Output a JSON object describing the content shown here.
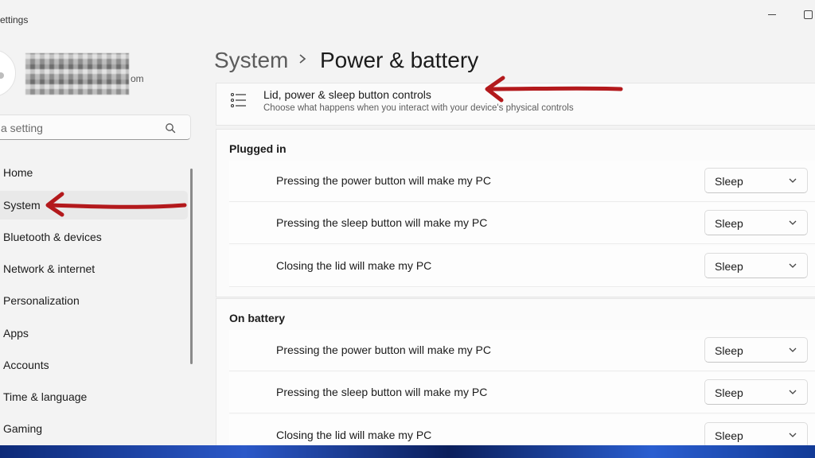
{
  "window": {
    "app_title": "ettings"
  },
  "account": {
    "email_suffix": "om"
  },
  "search": {
    "placeholder": "a setting"
  },
  "sidebar": {
    "items": [
      {
        "label": "Home"
      },
      {
        "label": "System"
      },
      {
        "label": "Bluetooth & devices"
      },
      {
        "label": "Network & internet"
      },
      {
        "label": "Personalization"
      },
      {
        "label": "Apps"
      },
      {
        "label": "Accounts"
      },
      {
        "label": "Time & language"
      },
      {
        "label": "Gaming"
      }
    ]
  },
  "header": {
    "breadcrumb_parent": "System",
    "title": "Power & battery"
  },
  "lid_card": {
    "title": "Lid, power & sleep button controls",
    "description": "Choose what happens when you interact with your device's physical controls"
  },
  "plugged_in": {
    "title": "Plugged in",
    "rows": [
      {
        "label": "Pressing the power button will make my PC",
        "value": "Sleep"
      },
      {
        "label": "Pressing the sleep button will make my PC",
        "value": "Sleep"
      },
      {
        "label": "Closing the lid will make my PC",
        "value": "Sleep"
      }
    ]
  },
  "on_battery": {
    "title": "On battery",
    "rows": [
      {
        "label": "Pressing the power button will make my PC",
        "value": "Sleep"
      },
      {
        "label": "Pressing the sleep button will make my PC",
        "value": "Sleep"
      },
      {
        "label": "Closing the lid will make my PC",
        "value": "Sleep"
      }
    ]
  },
  "colors": {
    "annotation_arrow": "#b3191c",
    "window_bg": "#f3f3f3",
    "card_bg": "#fbfbfb"
  },
  "icons": [
    "search-icon",
    "chevron-right-icon",
    "list-icon",
    "chevron-down-icon",
    "minimize-icon",
    "maximize-icon"
  ]
}
